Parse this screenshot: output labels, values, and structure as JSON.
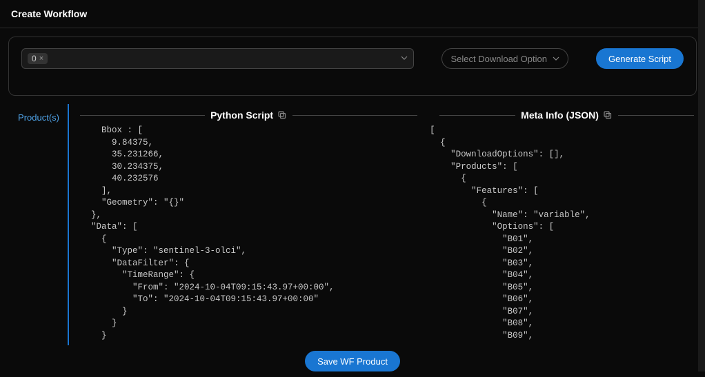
{
  "header": {
    "title": "Create Workflow"
  },
  "controls": {
    "tag_value": "0",
    "tag_close": "×",
    "download_placeholder": "Select Download Option",
    "generate_label": "Generate Script"
  },
  "sidebar": {
    "tabs": [
      {
        "label": "Product(s)"
      }
    ]
  },
  "panels": {
    "python": {
      "title": "Python Script",
      "code": "      Bbox : [\n        9.84375,\n        35.231266,\n        30.234375,\n        40.232576\n      ],\n      \"Geometry\": \"{}\"\n    },\n    \"Data\": [\n      {\n        \"Type\": \"sentinel-3-olci\",\n        \"DataFilter\": {\n          \"TimeRange\": {\n            \"From\": \"2024-10-04T09:15:43.97+00:00\",\n            \"To\": \"2024-10-04T09:15:43.97+00:00\"\n          }\n        }\n      }"
    },
    "meta": {
      "title": "Meta Info (JSON)",
      "code": "[\n  {\n    \"DownloadOptions\": [],\n    \"Products\": [\n      {\n        \"Features\": [\n          {\n            \"Name\": \"variable\",\n            \"Options\": [\n              \"B01\",\n              \"B02\",\n              \"B03\",\n              \"B04\",\n              \"B05\",\n              \"B06\",\n              \"B07\",\n              \"B08\",\n              \"B09\","
    }
  },
  "footer": {
    "save_label": "Save WF Product"
  }
}
